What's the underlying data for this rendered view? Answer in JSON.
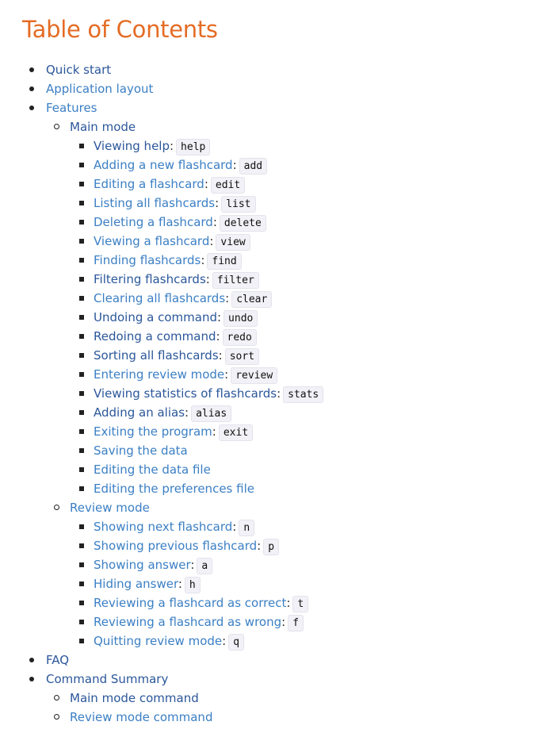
{
  "title": "Table of Contents",
  "colors": {
    "title": "#e46c25",
    "link": "#3b7fc4",
    "highlight": "#f7f722"
  },
  "toc": {
    "quick_start": "Quick start",
    "application_layout": "Application layout",
    "features": "Features",
    "main_mode": "Main mode",
    "main_items": [
      {
        "text": "Viewing help",
        "cmd": "help",
        "plain": true
      },
      {
        "text": "Adding a new flashcard",
        "cmd": "add"
      },
      {
        "text": "Editing a flashcard",
        "cmd": "edit"
      },
      {
        "text": "Listing all flashcards",
        "cmd": "list"
      },
      {
        "text": "Deleting a flashcard",
        "cmd": "delete"
      },
      {
        "text": "Viewing a flashcard",
        "cmd": "view"
      },
      {
        "text": "Finding flashcards",
        "cmd": "find"
      },
      {
        "text": "Filtering flashcards",
        "cmd": "filter",
        "plain": true
      },
      {
        "text": "Clearing all flashcards",
        "cmd": "clear"
      },
      {
        "text": "Undoing a command",
        "cmd": "undo",
        "plain": true
      },
      {
        "text": "Redoing a command",
        "cmd": "redo",
        "plain": true
      },
      {
        "text": "Sorting all flashcards",
        "cmd": "sort",
        "plain": true
      },
      {
        "text": "Entering review mode",
        "cmd": "review"
      },
      {
        "text": "Viewing statistics of flashcards",
        "cmd": "stats",
        "plain": true
      },
      {
        "text": "Adding an alias",
        "cmd": "alias",
        "plain": true
      },
      {
        "text": "Exiting the program",
        "cmd": "exit"
      },
      {
        "text": "Saving the data"
      },
      {
        "text": "Editing the data file"
      },
      {
        "text": "Editing the preferences file"
      }
    ],
    "review_mode": "Review mode",
    "review_items": [
      {
        "text": "Showing next flashcard",
        "cmd": "n"
      },
      {
        "text": "Showing previous flashcard",
        "cmd": "p"
      },
      {
        "text": "Showing answer",
        "cmd": "a"
      },
      {
        "text": "Hiding answer",
        "cmd": "h"
      },
      {
        "text": "Reviewing a flashcard as correct",
        "cmd": "t"
      },
      {
        "text": "Reviewing a flashcard as wrong",
        "cmd": "f"
      },
      {
        "text": "Quitting review mode",
        "cmd": "q"
      }
    ],
    "faq": "FAQ",
    "command_summary": "Command Summary",
    "main_mode_command": "Main mode command",
    "review_mode_command": "Review mode command"
  }
}
